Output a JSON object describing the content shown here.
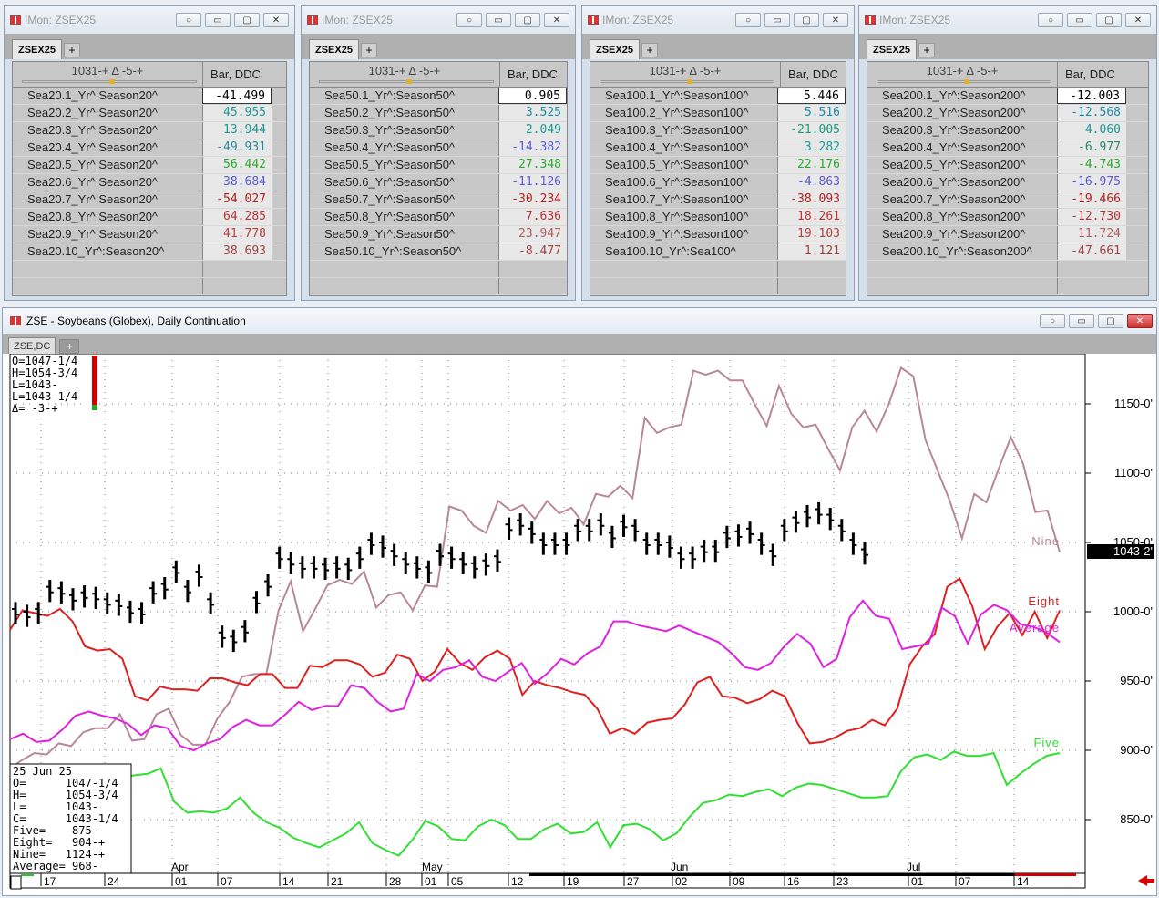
{
  "monitors": [
    {
      "title": "IMon: ZSEX25",
      "tab": "ZSEX25",
      "header_left": "1031-+     Δ -5-+",
      "header_right": "Bar, DDC",
      "rows": [
        {
          "label": "Sea20.1_Yr^:Season20^",
          "value": "-41.499",
          "color": "#000000"
        },
        {
          "label": "Sea20.2_Yr^:Season20^",
          "value": "45.955",
          "color": "#1a9a9a"
        },
        {
          "label": "Sea20.3_Yr^:Season20^",
          "value": "13.944",
          "color": "#1a9a9a"
        },
        {
          "label": "Sea20.4_Yr^:Season20^",
          "value": "-49.931",
          "color": "#2a8a9a"
        },
        {
          "label": "Sea20.5_Yr^:Season20^",
          "value": "56.442",
          "color": "#2aaa2a"
        },
        {
          "label": "Sea20.6_Yr^:Season20^",
          "value": "38.684",
          "color": "#5a5ad8"
        },
        {
          "label": "Sea20.7_Yr^:Season20^",
          "value": "-54.027",
          "color": "#b02020"
        },
        {
          "label": "Sea20.8_Yr^:Season20^",
          "value": "64.285",
          "color": "#c03030"
        },
        {
          "label": "Sea20.9_Yr^:Season20^",
          "value": "41.778",
          "color": "#b84040"
        },
        {
          "label": "Sea20.10_Yr^:Season20^",
          "value": "38.693",
          "color": "#a04040"
        }
      ]
    },
    {
      "title": "IMon: ZSEX25",
      "tab": "ZSEX25",
      "header_left": "1031-+     Δ -5-+",
      "header_right": "Bar, DDC",
      "rows": [
        {
          "label": "Sea50.1_Yr^:Season50^",
          "value": "0.905",
          "color": "#000000"
        },
        {
          "label": "Sea50.2_Yr^:Season50^",
          "value": "3.525",
          "color": "#1a8aaa"
        },
        {
          "label": "Sea50.3_Yr^:Season50^",
          "value": "2.049",
          "color": "#1a9a9a"
        },
        {
          "label": "Sea50.4_Yr^:Season50^",
          "value": "-14.382",
          "color": "#5a5ad8"
        },
        {
          "label": "Sea50.5_Yr^:Season50^",
          "value": "27.348",
          "color": "#2aaa2a"
        },
        {
          "label": "Sea50.6_Yr^:Season50^",
          "value": "-11.126",
          "color": "#5a5ad8"
        },
        {
          "label": "Sea50.7_Yr^:Season50^",
          "value": "-30.234",
          "color": "#b02020"
        },
        {
          "label": "Sea50.8_Yr^:Season50^",
          "value": "7.636",
          "color": "#c03030"
        },
        {
          "label": "Sea50.9_Yr^:Season50^",
          "value": "23.947",
          "color": "#b06060"
        },
        {
          "label": "Sea50.10_Yr^:Season50^",
          "value": "-8.477",
          "color": "#a04040"
        }
      ]
    },
    {
      "title": "IMon: ZSEX25",
      "tab": "ZSEX25",
      "header_left": "1031-+     Δ -5-+",
      "header_right": "Bar, DDC",
      "rows": [
        {
          "label": "Sea100.1_Yr^:Season100^",
          "value": "5.446",
          "color": "#000000"
        },
        {
          "label": "Sea100.2_Yr^:Season100^",
          "value": "5.516",
          "color": "#1a8aaa"
        },
        {
          "label": "Sea100.3_Yr^:Season100^",
          "value": "-21.005",
          "color": "#1a9a7a"
        },
        {
          "label": "Sea100.4_Yr^:Season100^",
          "value": "3.282",
          "color": "#1a9a9a"
        },
        {
          "label": "Sea100.5_Yr^:Season100^",
          "value": "22.176",
          "color": "#2aaa2a"
        },
        {
          "label": "Sea100.6_Yr^:Season100^",
          "value": "-4.863",
          "color": "#5a5ad8"
        },
        {
          "label": "Sea100.7_Yr^:Season100^",
          "value": "-38.093",
          "color": "#b02020"
        },
        {
          "label": "Sea100.8_Yr^:Season100^",
          "value": "18.261",
          "color": "#c03030"
        },
        {
          "label": "Sea100.9_Yr^:Season100^",
          "value": "19.103",
          "color": "#b04040"
        },
        {
          "label": "Sea100.10_Yr^:Sea100^",
          "value": "1.121",
          "color": "#a04040"
        }
      ]
    },
    {
      "title": "IMon: ZSEX25",
      "tab": "ZSEX25",
      "header_left": "1031-+     Δ -5-+",
      "header_right": "Bar, DDC",
      "rows": [
        {
          "label": "Sea200.1_Yr^:Season200^",
          "value": "-12.003",
          "color": "#000000"
        },
        {
          "label": "Sea200.2_Yr^:Season200^",
          "value": "-12.568",
          "color": "#1a8aaa"
        },
        {
          "label": "Sea200.3_Yr^:Season200^",
          "value": "4.060",
          "color": "#1a9a9a"
        },
        {
          "label": "Sea200.4_Yr^:Season200^",
          "value": "-6.977",
          "color": "#2a8a6a"
        },
        {
          "label": "Sea200.5_Yr^:Season200^",
          "value": "-4.743",
          "color": "#2aaa2a"
        },
        {
          "label": "Sea200.6_Yr^:Season200^",
          "value": "-16.975",
          "color": "#5a5ad8"
        },
        {
          "label": "Sea200.7_Yr^:Season200^",
          "value": "-19.466",
          "color": "#b02020"
        },
        {
          "label": "Sea200.8_Yr^:Season200^",
          "value": "-12.730",
          "color": "#c03030"
        },
        {
          "label": "Sea200.9_Yr^:Season200^",
          "value": "11.724",
          "color": "#b06060"
        },
        {
          "label": "Sea200.10_Yr^:Season200^",
          "value": "-47.661",
          "color": "#a04040"
        }
      ]
    }
  ],
  "chart_window": {
    "title": "ZSE - Soybeans (Globex), Daily Continuation",
    "tab": "ZSE,DC",
    "add_tab": "+"
  },
  "chart_data": {
    "type": "line",
    "y_axis": {
      "ticks": [
        850,
        900,
        950,
        1000,
        1050,
        1100,
        1150
      ],
      "tick_labels": [
        "850-0'",
        "900-0'",
        "950-0'",
        "1000-0'",
        "1050-0'",
        "1100-0'",
        "1150-0'"
      ],
      "range": [
        820,
        1180
      ]
    },
    "last_price_label": "1043-2'",
    "x_tick_labels": [
      "17",
      "24",
      "01",
      "07",
      "14",
      "21",
      "28",
      "01",
      "05",
      "12",
      "19",
      "27",
      "02",
      "09",
      "16",
      "23",
      "01",
      "07",
      "14"
    ],
    "month_labels": [
      "Apr",
      "May",
      "Jun",
      "Jul"
    ],
    "ohlc_box": [
      "O=1047-1/4",
      "H=1054-3/4",
      "L=1043-",
      "L=1043-1/4",
      "Δ=   -3-+"
    ],
    "info_box": [
      "25 Jun 25",
      "O=      1047-1/4",
      "H=      1054-3/4",
      "L=      1043-",
      "C=      1043-1/4",
      "Five=    875-",
      "Eight=   904-+",
      "Nine=   1124-+",
      "Average= 968-"
    ],
    "series": [
      {
        "name": "Nine",
        "color": "#b88898",
        "values": [
          887,
          893,
          898,
          897,
          905,
          903,
          913,
          916,
          916,
          926,
          907,
          908,
          926,
          930,
          911,
          904,
          904,
          923,
          935,
          953,
          955,
          955,
          1001,
          1022,
          986,
          1002,
          1019,
          1023,
          1020,
          1029,
          1003,
          1012,
          1014,
          1001,
          1019,
          1018,
          1076,
          1073,
          1062,
          1057,
          1080,
          1073,
          1077,
          1067,
          1080,
          1071,
          1075,
          1063,
          1085,
          1083,
          1091,
          1082,
          1140,
          1129,
          1133,
          1135,
          1174,
          1171,
          1174,
          1167,
          1167,
          1150,
          1134,
          1163,
          1143,
          1133,
          1135,
          1118,
          1102,
          1133,
          1145,
          1130,
          1150,
          1176,
          1170,
          1124,
          1102,
          1080,
          1053,
          1085,
          1079,
          1103,
          1126,
          1107,
          1072,
          1073,
          1043
        ]
      },
      {
        "name": "Eight",
        "color": "#e02020",
        "values": [
          987,
          1001,
          999,
          997,
          1002,
          993,
          975,
          972,
          973,
          966,
          939,
          936,
          946,
          944,
          944,
          943,
          952,
          952,
          949,
          947,
          955,
          955,
          945,
          945,
          961,
          960,
          965,
          965,
          962,
          953,
          956,
          969,
          966,
          950,
          957,
          973,
          963,
          958,
          967,
          972,
          966,
          940,
          950,
          947,
          945,
          942,
          940,
          930,
          912,
          916,
          912,
          920,
          922,
          923,
          933,
          949,
          953,
          939,
          938,
          934,
          937,
          943,
          939,
          920,
          905,
          906,
          909,
          914,
          916,
          922,
          918,
          930,
          962,
          975,
          984,
          1018,
          1024,
          1004,
          973,
          989,
          999,
          983,
          1000,
          981,
          1001
        ]
      },
      {
        "name": "Average",
        "color": "#e020e0",
        "values": [
          908,
          912,
          906,
          907,
          915,
          925,
          928,
          925,
          923,
          919,
          911,
          918,
          916,
          903,
          900,
          905,
          908,
          917,
          922,
          918,
          918,
          926,
          935,
          929,
          932,
          932,
          947,
          945,
          935,
          928,
          930,
          955,
          950,
          958,
          960,
          965,
          953,
          950,
          957,
          963,
          948,
          956,
          966,
          962,
          970,
          975,
          993,
          993,
          990,
          988,
          986,
          990,
          986,
          982,
          978,
          970,
          960,
          958,
          963,
          975,
          984,
          977,
          960,
          966,
          996,
          1008,
          997,
          995,
          973,
          975,
          977,
          1003,
          997,
          977,
          998,
          1005,
          1001,
          991,
          989,
          985,
          978
        ]
      },
      {
        "name": "Five",
        "color": "#30e030",
        "values": [
          880,
          882,
          883,
          887,
          863,
          855,
          856,
          855,
          858,
          866,
          855,
          848,
          844,
          837,
          833,
          830,
          835,
          840,
          848,
          833,
          828,
          824,
          835,
          849,
          845,
          836,
          835,
          845,
          850,
          846,
          836,
          836,
          843,
          847,
          840,
          841,
          848,
          830,
          846,
          847,
          843,
          835,
          840,
          852,
          862,
          864,
          868,
          867,
          870,
          872,
          867,
          873,
          876,
          875,
          872,
          869,
          866,
          866,
          867,
          885,
          895,
          897,
          893,
          899,
          896,
          896,
          898,
          875,
          883,
          890,
          896,
          898
        ]
      }
    ],
    "series_labels": [
      "Nine",
      "Eight",
      "Average",
      "Five"
    ]
  }
}
